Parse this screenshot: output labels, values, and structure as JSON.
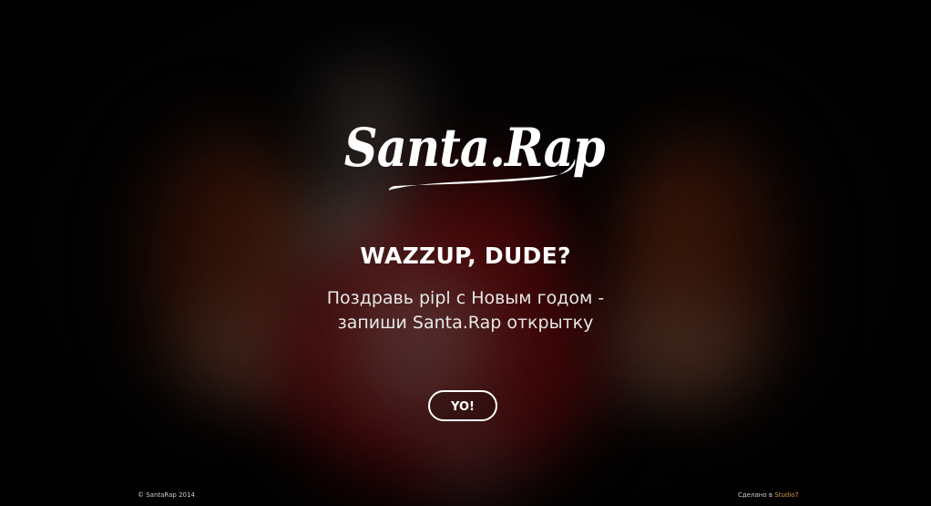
{
  "logo": {
    "text": "Santa.Rap"
  },
  "hero": {
    "headline": "WAZZUP, DUDE?",
    "tagline_line1": "Поздравь pipl с Новым годом -",
    "tagline_line2": "запиши Santa.Rap открытку",
    "button_label": "YO!"
  },
  "footer": {
    "copyright": "© SantaRap 2014",
    "made_by_prefix": "Сделано в",
    "made_by_link": "Studio7"
  },
  "colors": {
    "background": "#050505",
    "santa_red": "#7a0c10",
    "curtain_orange": "#6a2a10",
    "link_accent": "#d89a3a"
  }
}
